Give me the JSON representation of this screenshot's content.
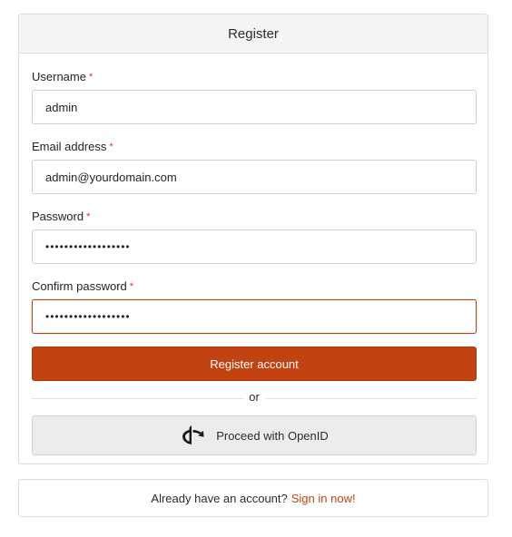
{
  "header": {
    "title": "Register"
  },
  "form": {
    "username": {
      "label": "Username",
      "value": "admin"
    },
    "email": {
      "label": "Email address",
      "value": "admin@yourdomain.com"
    },
    "password": {
      "label": "Password",
      "value": "••••••••••••••••••"
    },
    "confirm_password": {
      "label": "Confirm password",
      "value": "••••••••••••••••••"
    },
    "required_marker": "*"
  },
  "actions": {
    "register_label": "Register account",
    "divider_text": "or",
    "openid_label": "Proceed with OpenID"
  },
  "footer": {
    "prompt": "Already have an account?",
    "link": "Sign in now!"
  },
  "colors": {
    "primary": "#c24211",
    "required": "#d9352b"
  }
}
